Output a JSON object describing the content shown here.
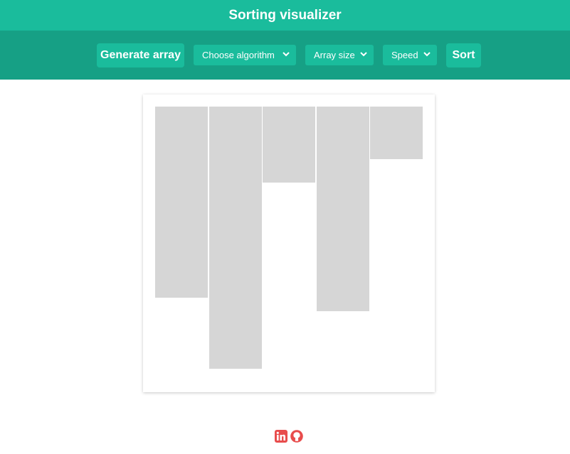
{
  "header": {
    "title": "Sorting visualizer"
  },
  "toolbar": {
    "generate_label": "Generate array",
    "algorithm_label": "Choose algorithm",
    "size_label": "Array size",
    "speed_label": "Speed",
    "sort_label": "Sort"
  },
  "chart_data": {
    "type": "bar",
    "values": [
      73,
      100,
      29,
      78,
      20
    ],
    "ylim": [
      0,
      100
    ]
  },
  "footer": {
    "icons": [
      "linkedin-icon",
      "github-icon"
    ]
  },
  "colors": {
    "header_bg": "#1abc9c",
    "toolbar_bg": "#16a085",
    "button_bg": "#1abc9c",
    "bar_fill": "#d6d6d6",
    "footer_icon": "#e84c4c"
  }
}
